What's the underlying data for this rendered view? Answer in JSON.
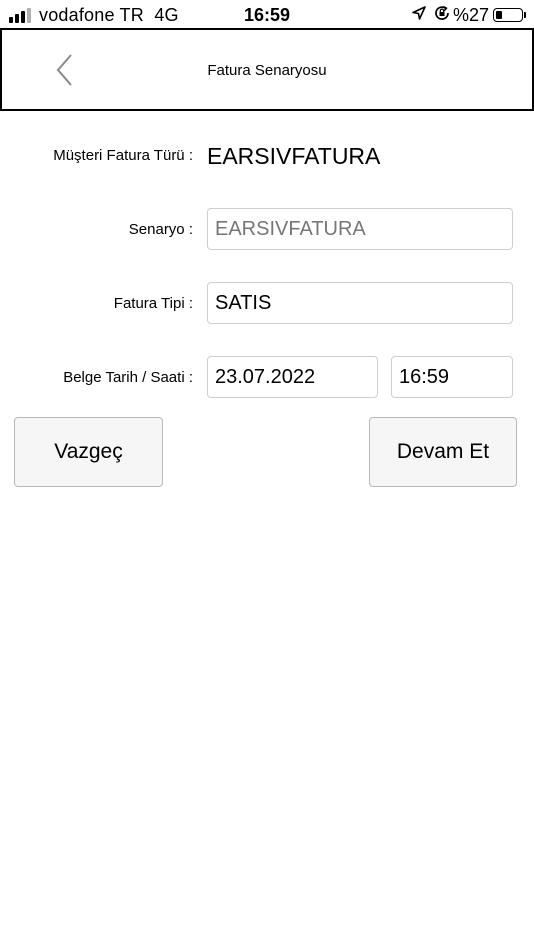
{
  "status_bar": {
    "carrier": "vodafone TR",
    "network": "4G",
    "time": "16:59",
    "battery_percent": "%27",
    "battery_level": 0.27,
    "icons": [
      "signal-icon",
      "location-arrow-icon",
      "rotation-lock-icon",
      "battery-icon"
    ]
  },
  "header": {
    "title": "Fatura Senaryosu",
    "back_icon": "chevron-left-icon"
  },
  "form": {
    "customer_invoice_type": {
      "label": "Müşteri Fatura Türü :",
      "value": "EARSIVFATURA"
    },
    "scenario": {
      "label": "Senaryo :",
      "value": "EARSIVFATURA"
    },
    "invoice_type": {
      "label": "Fatura Tipi :",
      "value": "SATIS"
    },
    "document_datetime": {
      "label": "Belge Tarih / Saati :",
      "date": "23.07.2022",
      "time": "16:59"
    }
  },
  "actions": {
    "cancel": "Vazgeç",
    "continue": "Devam Et"
  },
  "colors": {
    "background": "#ffffff",
    "field_border": "#cfcfcf",
    "button_border": "#b8b8b8",
    "disabled_text": "#777777"
  }
}
